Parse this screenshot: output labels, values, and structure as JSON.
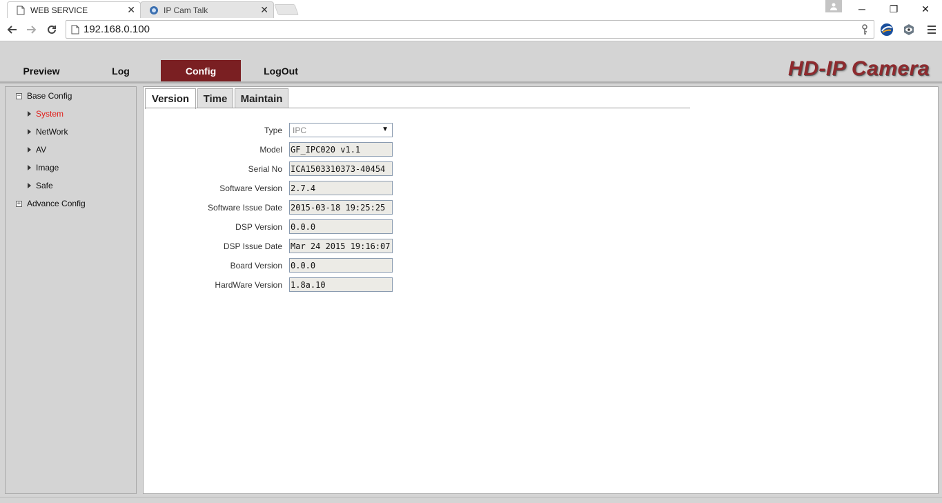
{
  "browser": {
    "tabs": [
      {
        "title": "WEB SERVICE",
        "close": "✕"
      },
      {
        "title": "IP Cam Talk",
        "close": "✕"
      }
    ],
    "window_controls": {
      "minimize": "─",
      "restore": "❐",
      "close": "✕"
    },
    "address": "192.168.0.100",
    "icons": [
      "back-arrow-icon",
      "forward-arrow-icon",
      "reload-icon",
      "page-icon",
      "key-icon",
      "extension-icon",
      "eye-icon",
      "menu-icon"
    ]
  },
  "header": {
    "menu": [
      {
        "label": "Preview",
        "active": false
      },
      {
        "label": "Log",
        "active": false
      },
      {
        "label": "Config",
        "active": true
      },
      {
        "label": "LogOut",
        "active": false
      }
    ],
    "brand": "HD-IP Camera",
    "accent_color": "#7a1f22"
  },
  "sidebar": {
    "base_config": {
      "label": "Base Config",
      "toggle": "−"
    },
    "items": [
      {
        "label": "System",
        "selected": true
      },
      {
        "label": "NetWork",
        "selected": false
      },
      {
        "label": "AV",
        "selected": false
      },
      {
        "label": "Image",
        "selected": false
      },
      {
        "label": "Safe",
        "selected": false
      }
    ],
    "advance_config": {
      "label": "Advance Config",
      "toggle": "+"
    }
  },
  "content": {
    "tabs": [
      {
        "label": "Version",
        "active": true
      },
      {
        "label": "Time",
        "active": false
      },
      {
        "label": "Maintain",
        "active": false
      }
    ],
    "type": {
      "label": "Type",
      "value": "IPC",
      "caret": "▼"
    },
    "fields": [
      {
        "label": "Model",
        "value": "GF_IPC020 v1.1"
      },
      {
        "label": "Serial No",
        "value": "ICA1503310373-40454"
      },
      {
        "label": "Software Version",
        "value": "2.7.4"
      },
      {
        "label": "Software Issue Date",
        "value": "2015-03-18 19:25:25"
      },
      {
        "label": "DSP Version",
        "value": "0.0.0"
      },
      {
        "label": "DSP Issue Date",
        "value": "Mar 24 2015 19:16:07"
      },
      {
        "label": "Board Version",
        "value": "0.0.0"
      },
      {
        "label": "HardWare Version",
        "value": "1.8a.10"
      }
    ]
  }
}
